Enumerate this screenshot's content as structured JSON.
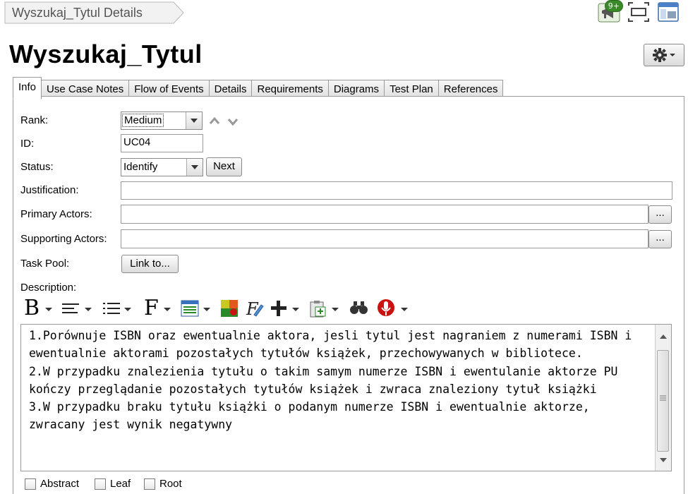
{
  "breadcrumb": {
    "label": "Wyszukaj_Tytul Details"
  },
  "header": {
    "notification_badge": "9+"
  },
  "page": {
    "title": "Wyszukaj_Tytul"
  },
  "tabs": [
    {
      "label": "Info"
    },
    {
      "label": "Use Case Notes"
    },
    {
      "label": "Flow of Events"
    },
    {
      "label": "Details"
    },
    {
      "label": "Requirements"
    },
    {
      "label": "Diagrams"
    },
    {
      "label": "Test Plan"
    },
    {
      "label": "References"
    }
  ],
  "form": {
    "rank_label": "Rank:",
    "rank_value": "Medium",
    "id_label": "ID:",
    "id_value": "UC04",
    "status_label": "Status:",
    "status_value": "Identify",
    "next_label": "Next",
    "justification_label": "Justification:",
    "justification_value": "",
    "primary_actors_label": "Primary Actors:",
    "primary_actors_value": "",
    "supporting_actors_label": "Supporting Actors:",
    "supporting_actors_value": "",
    "browse_label": "...",
    "task_pool_label": "Task Pool:",
    "link_to_label": "Link to...",
    "description_label": "Description:"
  },
  "toolbar": {
    "bold_glyph": "B",
    "font_glyph": "F"
  },
  "description": {
    "text": "1.Porównuje ISBN oraz ewentualnie aktora, jesli tytul jest nagraniem z numerami ISBN i ewentualnie aktorami pozostałych tytułów książek, przechowywanych w bibliotece.\n2.W przypadku znalezienia tytułu o takim samym numerze ISBN i ewentulanie aktorze PU kończy przeglądanie pozostałych tytułów książek i zwraca znaleziony tytuł książki\n3.W przypadku braku tytułu książki o podanym numerze ISBN i ewentualnie aktorze, zwracany jest wynik negatywny"
  },
  "flags": [
    {
      "label": "Abstract",
      "checked": false
    },
    {
      "label": "Leaf",
      "checked": false
    },
    {
      "label": "Root",
      "checked": false
    }
  ],
  "colors": {
    "badge": "#3a8a2a",
    "recorder": "#cc1111",
    "spellcheck_underline": "#d00000"
  }
}
